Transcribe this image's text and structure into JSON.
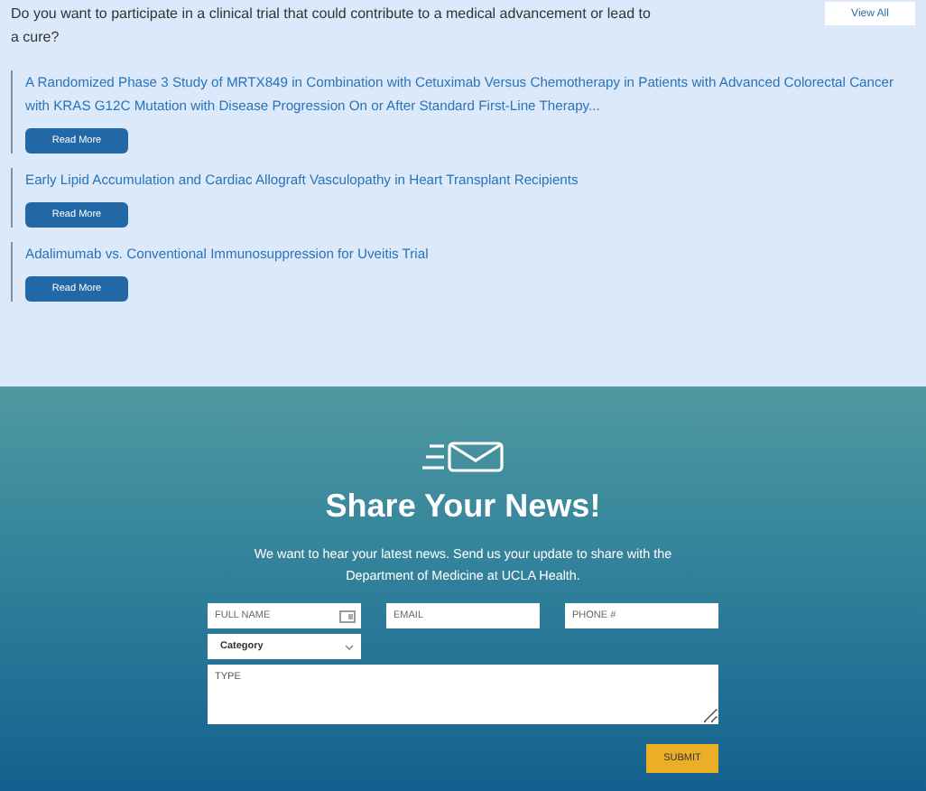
{
  "intro": {
    "text": "Do you want to participate in a clinical trial that could contribute to a medical advancement or lead to a cure?",
    "button": "View All"
  },
  "trials": [
    {
      "title": "A Randomized Phase 3 Study of MRTX849 in Combination with Cetuximab Versus Chemotherapy in Patients with Advanced Colorectal Cancer with KRAS G12C Mutation with Disease Progression On or After Standard First-Line Therapy...",
      "button": "Read More"
    },
    {
      "title": "Early Lipid Accumulation and Cardiac Allograft Vasculopathy in Heart Transplant Recipients",
      "button": "Read More"
    },
    {
      "title": "Adalimumab vs. Conventional Immunosuppression for Uveitis Trial",
      "button": "Read More"
    }
  ],
  "news": {
    "heading": "Share Your News!",
    "text": "We want to hear your latest news. Send us your update to share with the Department of Medicine at UCLA Health.",
    "fields": [
      {
        "placeholder": "FULL NAME"
      },
      {
        "placeholder": "EMAIL"
      },
      {
        "placeholder": "PHONE #"
      }
    ],
    "category": "Category",
    "message_placeholder": "TYPE",
    "submit": "SUBMIT"
  }
}
